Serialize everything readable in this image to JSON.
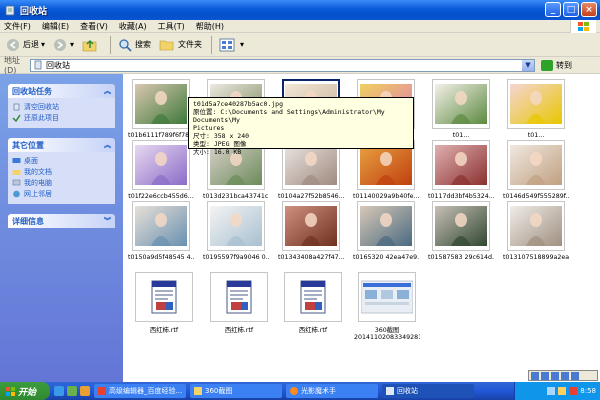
{
  "window": {
    "title": "回收站",
    "min": "_",
    "max": "□",
    "close": "×"
  },
  "menu": [
    "文件(F)",
    "编辑(E)",
    "查看(V)",
    "收藏(A)",
    "工具(T)",
    "帮助(H)"
  ],
  "toolbar": {
    "back": "后退",
    "search": "搜索",
    "folders": "文件夹"
  },
  "address": {
    "label": "地址(D)",
    "value": "回收站",
    "go": "转到"
  },
  "tasks": {
    "title": "回收站任务",
    "items": [
      "清空回收站",
      "还原此项目"
    ]
  },
  "places": {
    "title": "其它位置",
    "items": [
      "桌面",
      "我的文档",
      "我的电脑",
      "网上邻居"
    ]
  },
  "details": {
    "title": "详细信息"
  },
  "files": [
    {
      "name": "t01b6111f789f6f78...",
      "kind": "photo",
      "c1": "#3e7a3a",
      "c2": "#d9c7b0"
    },
    {
      "name": "t01d2b616e6ea05f2...",
      "kind": "photo",
      "c1": "#7e8d60",
      "c2": "#ece8e0"
    },
    {
      "name": "t01d5a7ce40287b5ac0.jpg",
      "kind": "photo",
      "c1": "#c9b49a",
      "c2": "#f2e6d6"
    },
    {
      "name": "t01...",
      "kind": "photo",
      "c1": "#e07ab0",
      "c2": "#f0d060"
    },
    {
      "name": "t01...",
      "kind": "photo",
      "c1": "#5c8a40",
      "c2": "#f4f0e8"
    },
    {
      "name": "t01...",
      "kind": "photo",
      "c1": "#e8c700",
      "c2": "#f5d5d5"
    },
    {
      "name": "t01f22e6ccb455d6...",
      "kind": "photo",
      "c1": "#8a6cc8",
      "c2": "#e8d8f0"
    },
    {
      "name": "t013d231bca43741c...",
      "kind": "photo",
      "c1": "#6b8b5a",
      "c2": "#d8d0c8"
    },
    {
      "name": "t0104a27f52b8546...",
      "kind": "photo",
      "c1": "#a08a80",
      "c2": "#e8e4e0"
    },
    {
      "name": "t01140029a9b40fe...",
      "kind": "photo",
      "c1": "#c04010",
      "c2": "#e8a040"
    },
    {
      "name": "t0117dd3bf4b5324...",
      "kind": "photo",
      "c1": "#8a3030",
      "c2": "#e0b0b0"
    },
    {
      "name": "t0146d549f555289f...",
      "kind": "photo",
      "c1": "#c0a080",
      "c2": "#f0e8e0"
    },
    {
      "name": "t0150a9d5f48545 4...",
      "kind": "photo",
      "c1": "#6890b0",
      "c2": "#e8e0d8"
    },
    {
      "name": "t0195597f9a9046 0...",
      "kind": "photo",
      "c1": "#a8c0d0",
      "c2": "#f4f4f4"
    },
    {
      "name": "t01343408a427f47...",
      "kind": "photo",
      "c1": "#703020",
      "c2": "#d09080"
    },
    {
      "name": "t0165320 42ea47e9...",
      "kind": "photo",
      "c1": "#4a6a80",
      "c2": "#d8c8b8"
    },
    {
      "name": "t01587583 29c614d...",
      "kind": "photo",
      "c1": "#304830",
      "c2": "#c8c0b8"
    },
    {
      "name": "t013107518899a2ea...",
      "kind": "photo",
      "c1": "#a09080",
      "c2": "#f0ece8"
    },
    {
      "name": "西红柿.rtf",
      "kind": "rtf"
    },
    {
      "name": "西红柿.rtf",
      "kind": "rtf"
    },
    {
      "name": "西红柿.rtf",
      "kind": "rtf"
    },
    {
      "name": "360截图",
      "name2": "20141102083349281...",
      "kind": "shot"
    }
  ],
  "tooltip": {
    "line1": "t01d5a7ce40287b5ac0.jpg",
    "line2": "原位置: C:\\Documents and Settings\\Administrator\\My Documents\\My",
    "line3": "Pictures",
    "line4": "尺寸: 358 x 240",
    "line5": "类型: JPEG 图像",
    "line6": "大小: 16.0 KB"
  },
  "taskbar": {
    "start": "开始",
    "tasks": [
      "高级编辑器_百度经验...",
      "360截图",
      "光影魔术手",
      "回收站"
    ],
    "clock": "8:58"
  },
  "colors": {
    "accent": "#0a5ad8",
    "pane": "#6f8fe0",
    "selection": "#316ac5"
  }
}
